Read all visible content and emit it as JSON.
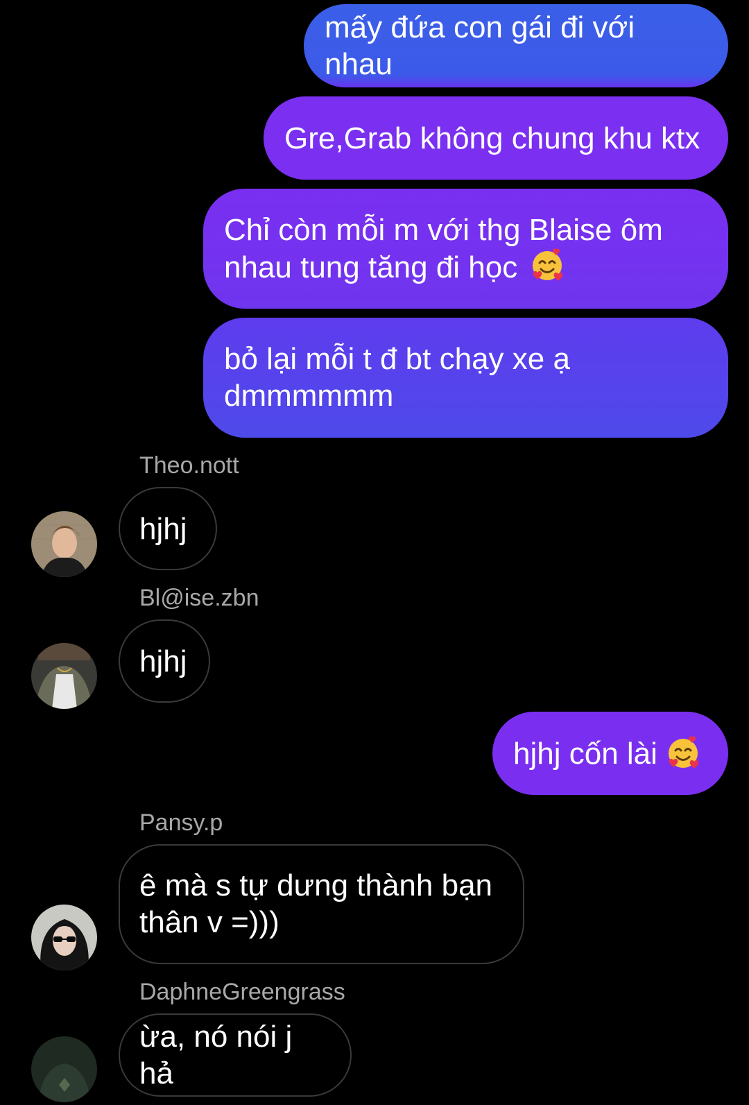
{
  "messages": {
    "out1": "mấy đứa con gái đi với nhau",
    "out2": "Gre,Grab không chung khu ktx",
    "out3_line1": "Chỉ còn mỗi m với thg Blaise ôm",
    "out3_line2": "nhau tung tăng đi học",
    "out4_line1": "bỏ lại mỗi t đ bt chạy xe ạ",
    "out4_line2": "dmmmmmm",
    "out5": "hjhj cốn lài",
    "theo_text": "hjhj",
    "blaise_text": "hjhj",
    "pansy_line1": "ê mà s tự dưng thành bạn",
    "pansy_line2": "thân v =)))",
    "daphne_text": "ừa, nó nói j hả"
  },
  "senders": {
    "theo": "Theo.nott",
    "blaise": "Bl@ise.zbn",
    "pansy": "Pansy.p",
    "daphne": "DaphneGreengrass"
  },
  "colors": {
    "background": "#000000",
    "bubble_blue": "#3d5ce9",
    "bubble_violet": "#7a2ef0",
    "bubble_indigo": "#5545ea",
    "incoming_border": "#3a3a3a",
    "sender_name": "#a8a8a8"
  },
  "icons": {
    "emoji": "smiling-face-with-hearts-emoji"
  }
}
